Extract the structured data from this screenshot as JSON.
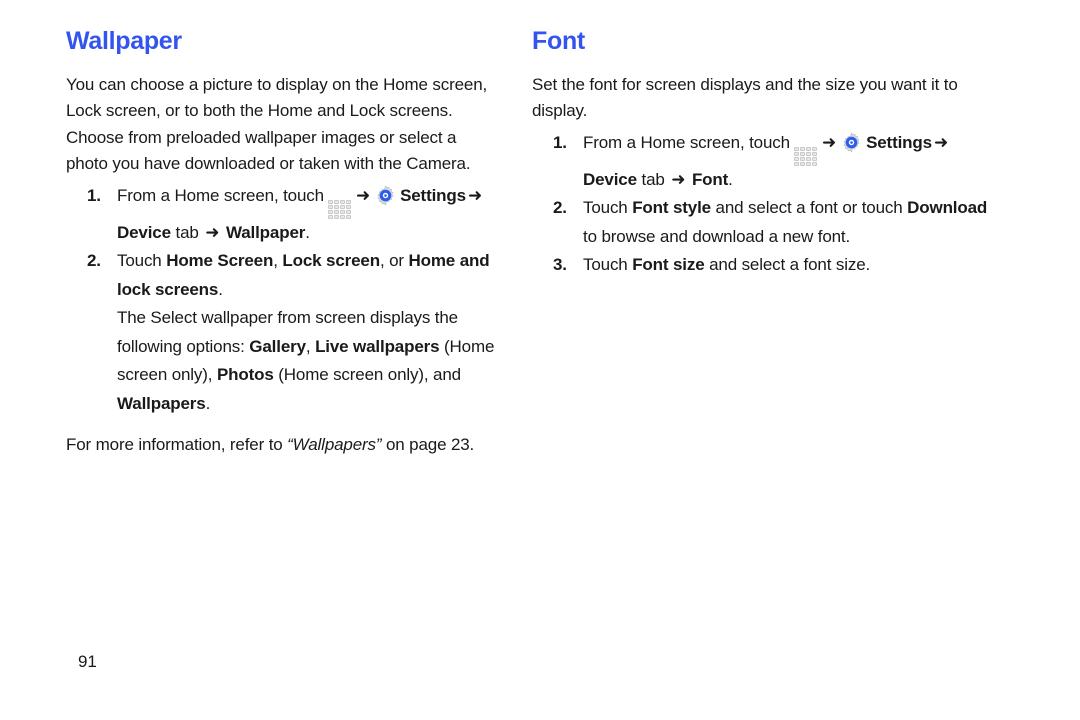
{
  "page": {
    "number": "91",
    "heading_color": "#3355ee",
    "text_color": "#1a1a1a",
    "background": "#ffffff"
  },
  "icons": {
    "apps_grid": "apps-grid-icon",
    "settings_gear": "settings-gear-icon",
    "arrow": "➜"
  },
  "left_column": {
    "title": "Wallpaper",
    "intro": "You can choose a picture to display on the Home screen, Lock screen, or to both the Home and Lock screens. Choose from preloaded wallpaper images or select a photo you have downloaded or taken with the Camera.",
    "steps": [
      {
        "number": "1.",
        "text_before_apps": "From a Home screen, touch",
        "text_after_gear": "Settings",
        "trail": [
          {
            "text": "Device",
            "bold": true
          },
          {
            "text": " tab ",
            "bold": false
          },
          {
            "text": "Wallpaper",
            "bold": true
          },
          {
            "text": ".",
            "bold": false
          }
        ]
      },
      {
        "number": "2.",
        "parts": [
          {
            "text": "Touch ",
            "bold": false
          },
          {
            "text": "Home Screen",
            "bold": true
          },
          {
            "text": ", ",
            "bold": false
          },
          {
            "text": "Lock screen",
            "bold": true
          },
          {
            "text": ", or ",
            "bold": false
          },
          {
            "text": "Home and lock screens",
            "bold": true
          },
          {
            "text": ".",
            "bold": false
          }
        ],
        "sub_paragraph": [
          {
            "text": "The Select wallpaper from screen displays the following options: ",
            "bold": false
          },
          {
            "text": "Gallery",
            "bold": true
          },
          {
            "text": ", ",
            "bold": false
          },
          {
            "text": "Live wallpapers",
            "bold": true
          },
          {
            "text": " (Home screen only), ",
            "bold": false
          },
          {
            "text": "Photos",
            "bold": true
          },
          {
            "text": " (Home screen only), and ",
            "bold": false
          },
          {
            "text": "Wallpapers",
            "bold": true
          },
          {
            "text": ".",
            "bold": false
          }
        ]
      }
    ],
    "note": [
      {
        "text": "For more information, refer to ",
        "style": "normal"
      },
      {
        "text": "“Wallpapers”",
        "style": "italic"
      },
      {
        "text": " on page 23.",
        "style": "normal"
      }
    ]
  },
  "right_column": {
    "title": "Font",
    "intro": "Set the font for screen displays and the size you want it to display.",
    "steps": [
      {
        "number": "1.",
        "text_before_apps": "From a Home screen, touch",
        "text_after_gear": "Settings",
        "trail": [
          {
            "text": "Device",
            "bold": true
          },
          {
            "text": " tab ",
            "bold": false
          },
          {
            "text": "Font",
            "bold": true
          },
          {
            "text": ".",
            "bold": false
          }
        ]
      },
      {
        "number": "2.",
        "parts": [
          {
            "text": "Touch ",
            "bold": false
          },
          {
            "text": "Font style",
            "bold": true
          },
          {
            "text": " and select a font or touch ",
            "bold": false
          },
          {
            "text": "Download",
            "bold": true
          },
          {
            "text": " to browse and download a new font.",
            "bold": false
          }
        ]
      },
      {
        "number": "3.",
        "parts": [
          {
            "text": "Touch ",
            "bold": false
          },
          {
            "text": "Font size",
            "bold": true
          },
          {
            "text": " and select a font size.",
            "bold": false
          }
        ]
      }
    ]
  }
}
